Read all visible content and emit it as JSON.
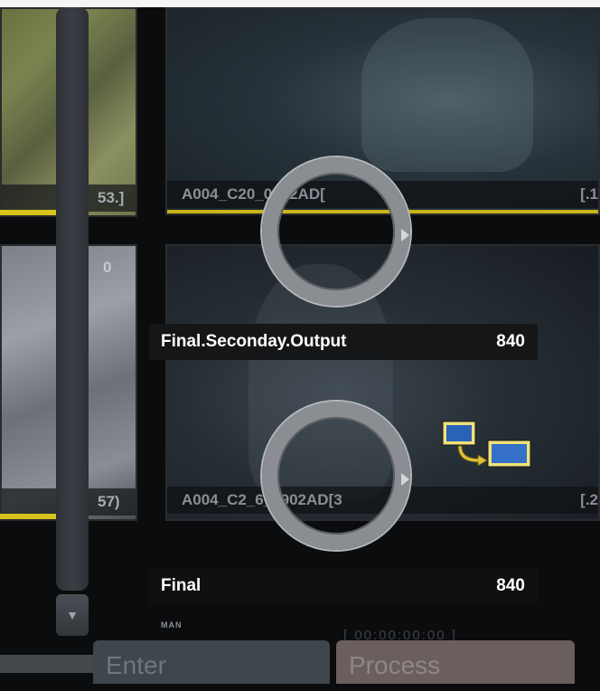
{
  "left_thumbs": [
    {
      "label": "53.]"
    },
    {
      "label": "57)",
      "top_value": "0"
    }
  ],
  "clips": [
    {
      "name": "A004_C20_0902AD[",
      "count": "[.1"
    },
    {
      "name": "A004_C2_6_0902AD[3",
      "count": "[.2"
    }
  ],
  "outputs": [
    {
      "name": "Final.Seconday.Output",
      "value": "840"
    },
    {
      "name": "Final",
      "value": "840"
    }
  ],
  "man_label": "MAN",
  "timecode": "[ 00:00:00:00 ]",
  "buttons": {
    "enter": "Enter",
    "process": "Process"
  },
  "icons": {
    "ring": "progress-ring-icon",
    "transfer": "transfer-icon",
    "scroll": "scroll-down-icon"
  },
  "colors": {
    "accent": "#d8c21c",
    "panel": "#141618",
    "process_button": "#6a5f5e",
    "enter_button": "#3f464c"
  }
}
